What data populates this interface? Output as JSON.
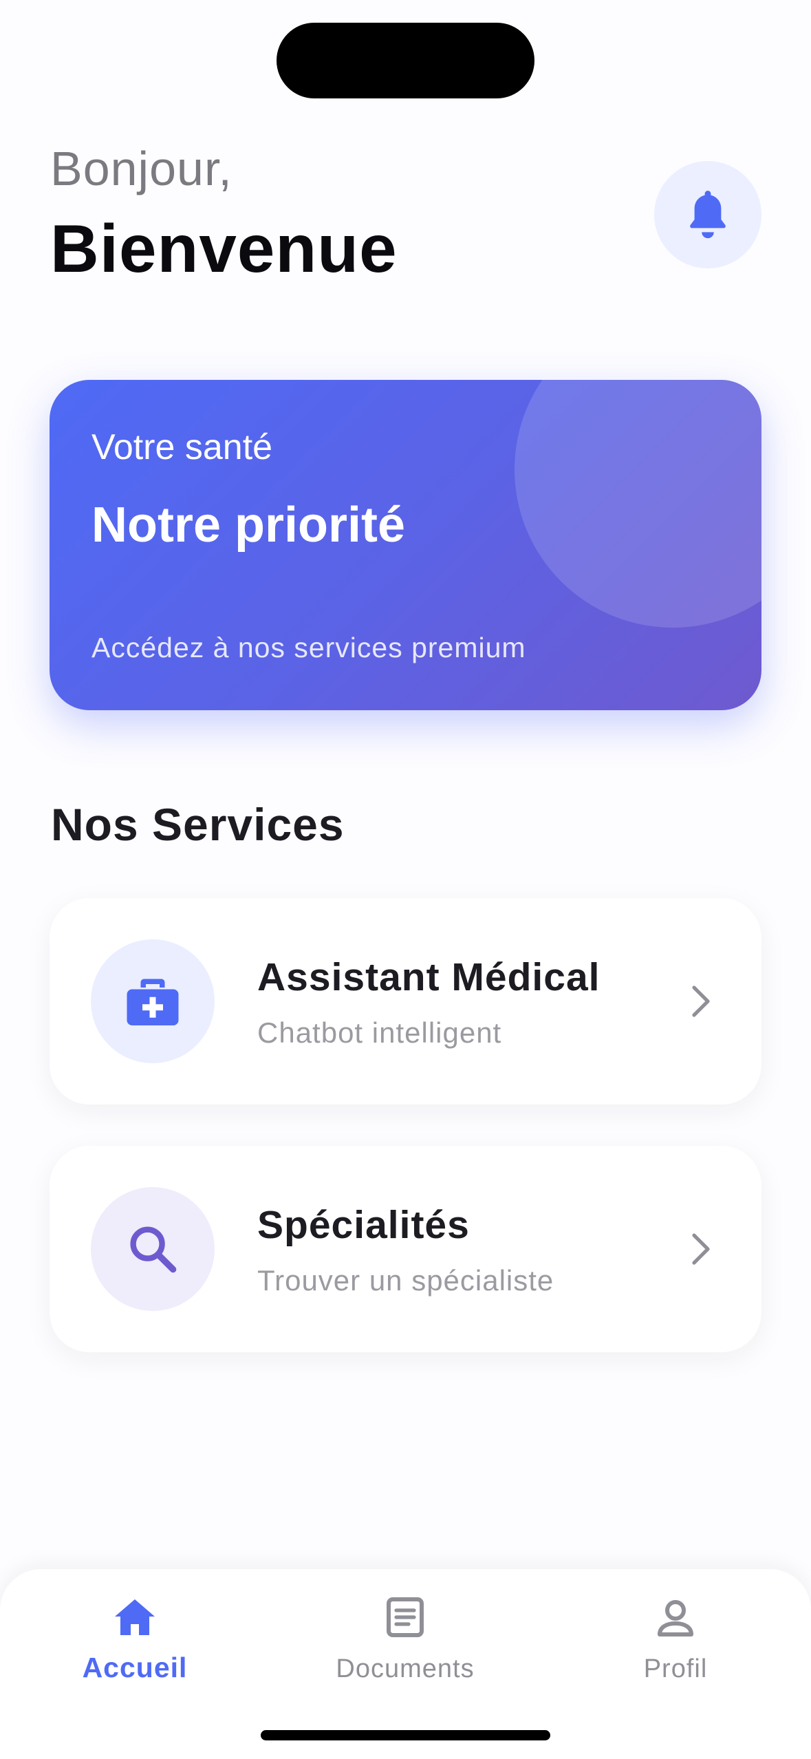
{
  "header": {
    "greeting": "Bonjour,",
    "welcome": "Bienvenue",
    "notification_icon": "bell-icon"
  },
  "hero": {
    "eyebrow": "Votre santé",
    "title": "Notre priorité",
    "subtitle": "Accédez à nos services premium"
  },
  "services": {
    "section_title": "Nos Services",
    "items": [
      {
        "title": "Assistant Médical",
        "subtitle": "Chatbot intelligent",
        "icon": "medical-kit-icon"
      },
      {
        "title": "Spécialités",
        "subtitle": "Trouver un spécialiste",
        "icon": "search-icon"
      }
    ]
  },
  "tabbar": {
    "items": [
      {
        "label": "Accueil",
        "icon": "home-icon",
        "active": true
      },
      {
        "label": "Documents",
        "icon": "document-icon",
        "active": false
      },
      {
        "label": "Profil",
        "icon": "user-icon",
        "active": false
      }
    ]
  },
  "colors": {
    "accent": "#4f6af5",
    "accent_violet": "#6e5acf",
    "icon_bg_blue": "#eaeeff",
    "icon_bg_violet": "#efecfb",
    "text_primary": "#1c1c22",
    "text_secondary": "#9a9aa0"
  }
}
